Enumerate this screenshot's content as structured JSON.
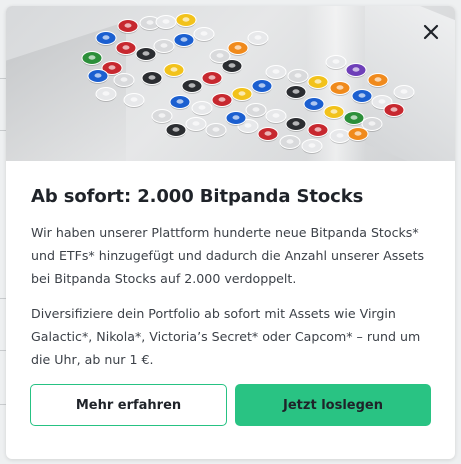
{
  "modal": {
    "title": "Ab sofort: 2.000 Bitpanda Stocks",
    "paragraph_1": "Wir haben unserer Plattform hunderte neue Bitpanda Stocks* und ETFs* hinzugefügt und dadurch die Anzahl unserer Assets bei Bitpanda Stocks auf 2.000 verdoppelt.",
    "paragraph_2": "Diversifiziere dein Portfolio ab sofort mit Assets wie Virgin Galactic*, Nikola*, Victoria’s Secret* oder Capcom* – rund um die Uhr, ab nur 1 €.",
    "close_icon": "close-icon",
    "hero_image": "stock-tokens-illustration"
  },
  "actions": {
    "learn_more_label": "Mehr erfahren",
    "get_started_label": "Jetzt loslegen"
  },
  "colors": {
    "accent": "#29c383",
    "title_text": "#1f2329",
    "body_text": "#3c4148",
    "token_palette": [
      "#c7282f",
      "#1b5fd0",
      "#2b2d31",
      "#f2c21b",
      "#f08a1c",
      "#d9dadc",
      "#e7e8ea",
      "#2c8f3a",
      "#6e3fb8"
    ]
  }
}
